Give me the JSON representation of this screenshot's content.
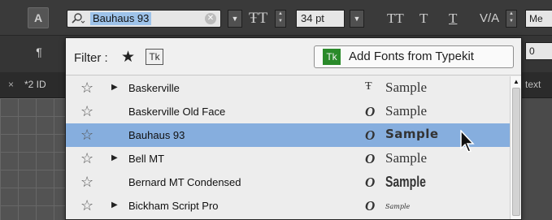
{
  "toolbar": {
    "char_tool": "A",
    "para_tool": "¶",
    "font_field_value": "Bauhaus 93",
    "font_size": "34 pt",
    "me_field": "Me",
    "zero_field": "0",
    "tt_buttons": [
      "TT",
      "T",
      "T"
    ],
    "va_label": "V/A"
  },
  "tab": {
    "close": "×",
    "label": "*2 ID",
    "right_label": "text"
  },
  "menu": {
    "filter_label": "Filter :",
    "filter_tk": "Tk",
    "typekit_logo": "Tk",
    "typekit_button": "Add Fonts from Typekit",
    "rows": [
      {
        "name": "Baskerville",
        "has_submenu": true,
        "type_glyph": "Ŧ",
        "sample": "Sample",
        "selected": false
      },
      {
        "name": "Baskerville Old Face",
        "has_submenu": false,
        "type_glyph": "O",
        "sample": "Sample",
        "selected": false
      },
      {
        "name": "Bauhaus 93",
        "has_submenu": false,
        "type_glyph": "O",
        "sample": "Sample",
        "selected": true
      },
      {
        "name": "Bell MT",
        "has_submenu": true,
        "type_glyph": "O",
        "sample": "Sample",
        "selected": false
      },
      {
        "name": "Bernard MT Condensed",
        "has_submenu": false,
        "type_glyph": "O",
        "sample": "Sample",
        "selected": false
      },
      {
        "name": "Bickham Script Pro",
        "has_submenu": true,
        "type_glyph": "O",
        "sample": "Sample",
        "selected": false
      }
    ]
  },
  "colors": {
    "selection": "#86aede",
    "menu_bg": "#ededed",
    "typekit_green": "#2a8a2a"
  }
}
